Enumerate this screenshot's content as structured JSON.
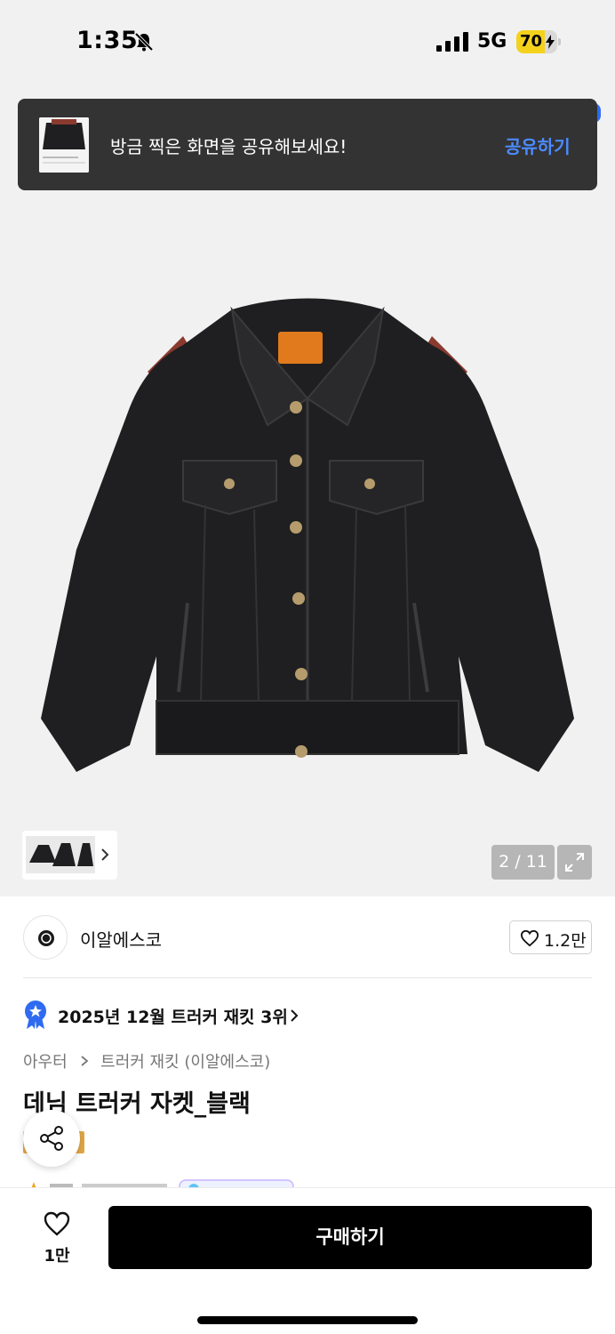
{
  "status_bar": {
    "time": "1:35",
    "network": "5G",
    "battery_percent": "70",
    "battery_level": 0.7,
    "icons": [
      "bell-slash-icon",
      "signal-icon",
      "battery-charging-icon"
    ]
  },
  "toast": {
    "message": "방금 찍은 화면을 공유해보세요!",
    "action_label": "공유하기",
    "accent_color": "#4c8bff"
  },
  "gallery": {
    "page_counter": "2 / 11",
    "current_page": 2,
    "total_pages": 11
  },
  "brand": {
    "name": "이알에스코",
    "likes": "1.2만"
  },
  "ranking": {
    "text": "2025년 12월 트러커 재킷 3위"
  },
  "breadcrumb": {
    "items": [
      "아우터",
      "트러커 재킷 (이알에스코)"
    ]
  },
  "product": {
    "title": "데님 트러커 자켓_블랙"
  },
  "bottom_bar": {
    "wish_count": "1만",
    "buy_label": "구매하기"
  },
  "colors": {
    "primary_button": "#000000",
    "toast_bg": "#333333",
    "rank_badge": "#2f6bf0",
    "promo_tag": "#e3a847"
  }
}
